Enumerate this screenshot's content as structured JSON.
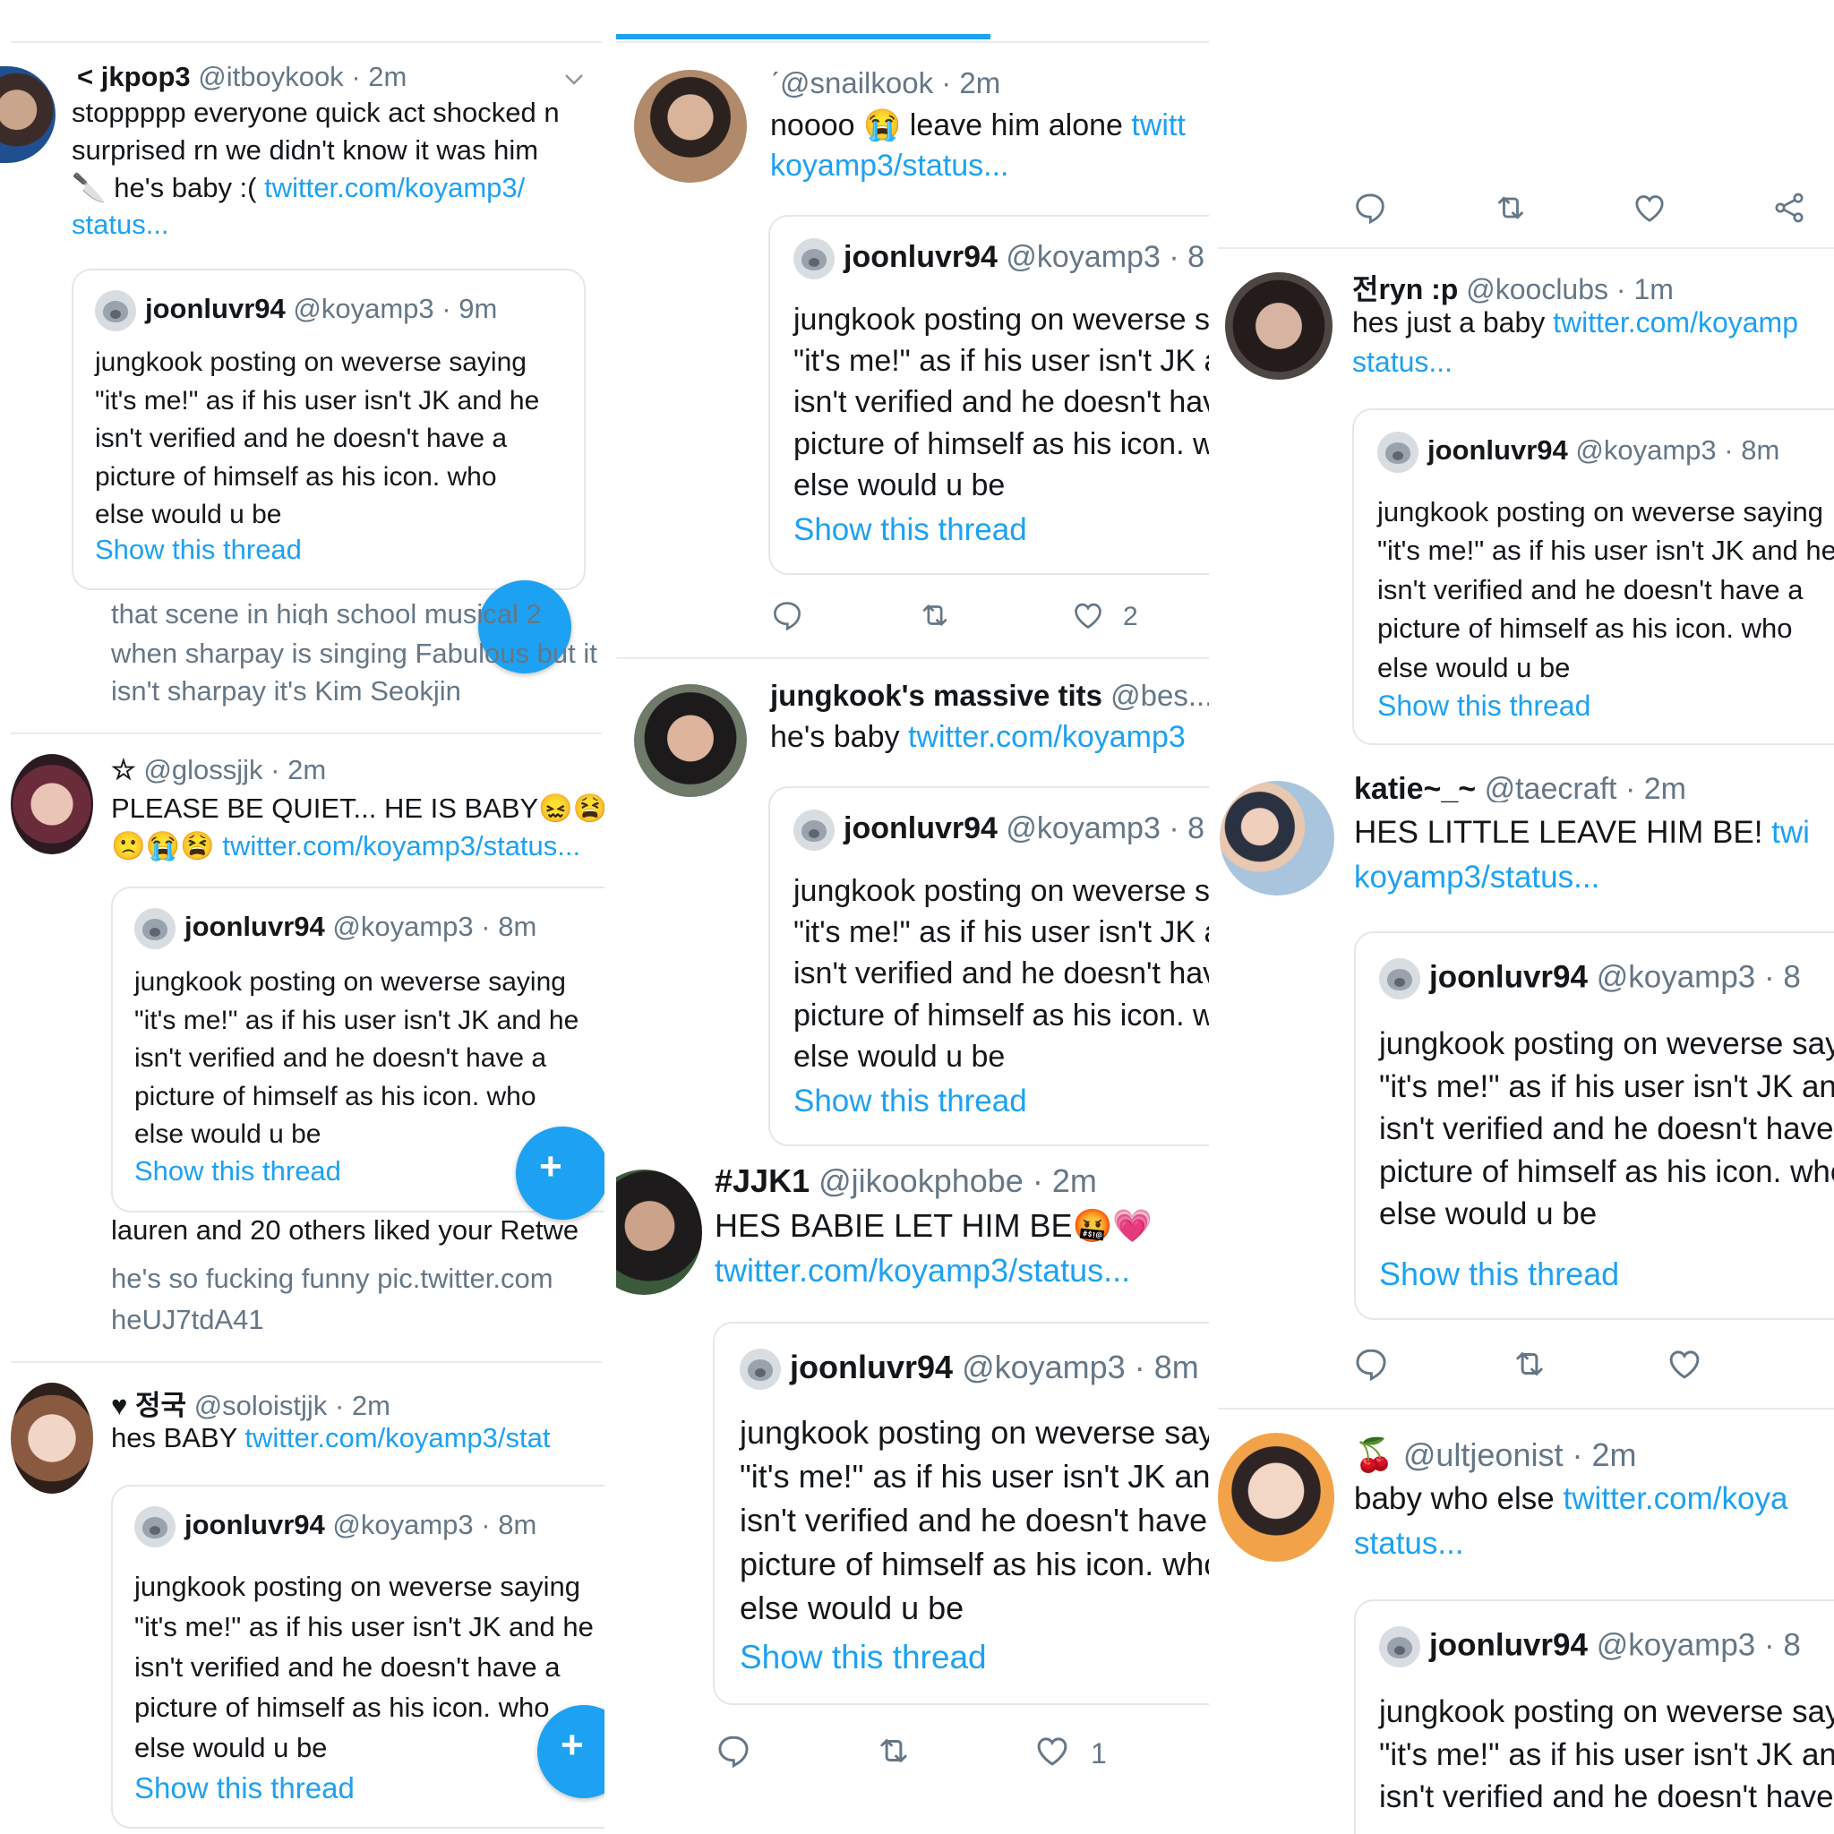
{
  "quote": {
    "name": "joonluvr94",
    "handle": "@koyamp3",
    "time_9m": "· 9m",
    "time_8m": "· 8m",
    "time_8": "· 8",
    "time_8m_cut": "· 8m",
    "time_8i": "· 8",
    "line1_full": "jungkook posting on weverse saying",
    "line2_full": "\"it's me!\" as if his user isn't JK and he",
    "line3_full": "isn't verified and he doesn't have a",
    "line4_full": "picture of himself as his icon. who",
    "line5": "else would u be",
    "show_thread": "Show this thread"
  },
  "col1": {
    "t1": {
      "name": "< jkpop3",
      "handle": "@itboykook",
      "time": "· 2m",
      "l1": "stoppppp everyone quick act shocked n",
      "l2": "surprised rn we didn't know it was him",
      "l3_text": "🔪 he's baby :(",
      "l3_link": "twitter.com/koyamp3/",
      "l4_link": "status..."
    },
    "partial": {
      "l1": "that scene in high school musical 2",
      "l2": "when sharpay is singing Fabulous but it",
      "l3": "isn't sharpay it's Kim Seokjin"
    },
    "t2": {
      "name": "☆",
      "handle": "@glossjjk",
      "time": "· 2m",
      "l1": "PLEASE BE QUIET... HE IS BABY😖😫😟",
      "l2_emoji": "🙁😭😫",
      "l2_link": "twitter.com/koyamp3/status..."
    },
    "liked": "lauren and 20 others liked your Retwe",
    "liked_l1": "he's so fucking funny pic.twitter.com",
    "liked_l2": "heUJ7tdA41",
    "t3": {
      "name": "♥ 정국",
      "handle": "@soloistjjk",
      "time": "· 2m",
      "l1_text": "hes BABY",
      "l1_link": "twitter.com/koyamp3/stat"
    }
  },
  "col2": {
    "t1": {
      "name": "ˊ",
      "handle": "@snailkook",
      "time": "· 2m",
      "l1_text": "noooo 😭 leave him alone",
      "l1_link": "twitt",
      "l2_link": "koyamp3/status..."
    },
    "t1_likes": "2",
    "t2": {
      "name": "jungkook's massive tits",
      "handle": "@bes...",
      "l1_text": "he's baby",
      "l1_link": "twitter.com/koyamp3"
    },
    "t3": {
      "name": "#JJK1",
      "handle": "@jikookphobe",
      "time": "· 2m",
      "l1": "HES BABIE LET HIM BE🤬💗",
      "l2_link": "twitter.com/koyamp3/status..."
    },
    "t3_likes": "1"
  },
  "col3": {
    "t1": {
      "name": "전ryn :p",
      "handle": "@kooclubs",
      "time": "· 1m",
      "l1_text": "hes just a baby",
      "l1_link": "twitter.com/koyamp",
      "l2_link": "status..."
    },
    "t2": {
      "name": "katie~_~",
      "handle": "@taecraft",
      "time": "· 2m",
      "l1_text": "HES LITTLE LEAVE HIM BE!",
      "l1_link": "twi",
      "l2_link": "koyamp3/status..."
    },
    "t3": {
      "name": "🍒",
      "handle": "@ultjeonist",
      "time": "· 2m",
      "l1_text": "baby who else",
      "l1_link": "twitter.com/koya",
      "l2_link": "status..."
    }
  },
  "colors": {
    "accent": "#1da1f2",
    "text": "#14171a",
    "muted": "#657786",
    "border": "#e1e8ed"
  },
  "icons": [
    "reply-icon",
    "retweet-icon",
    "like-icon",
    "share-icon",
    "compose-icon",
    "chevron-down-icon"
  ]
}
